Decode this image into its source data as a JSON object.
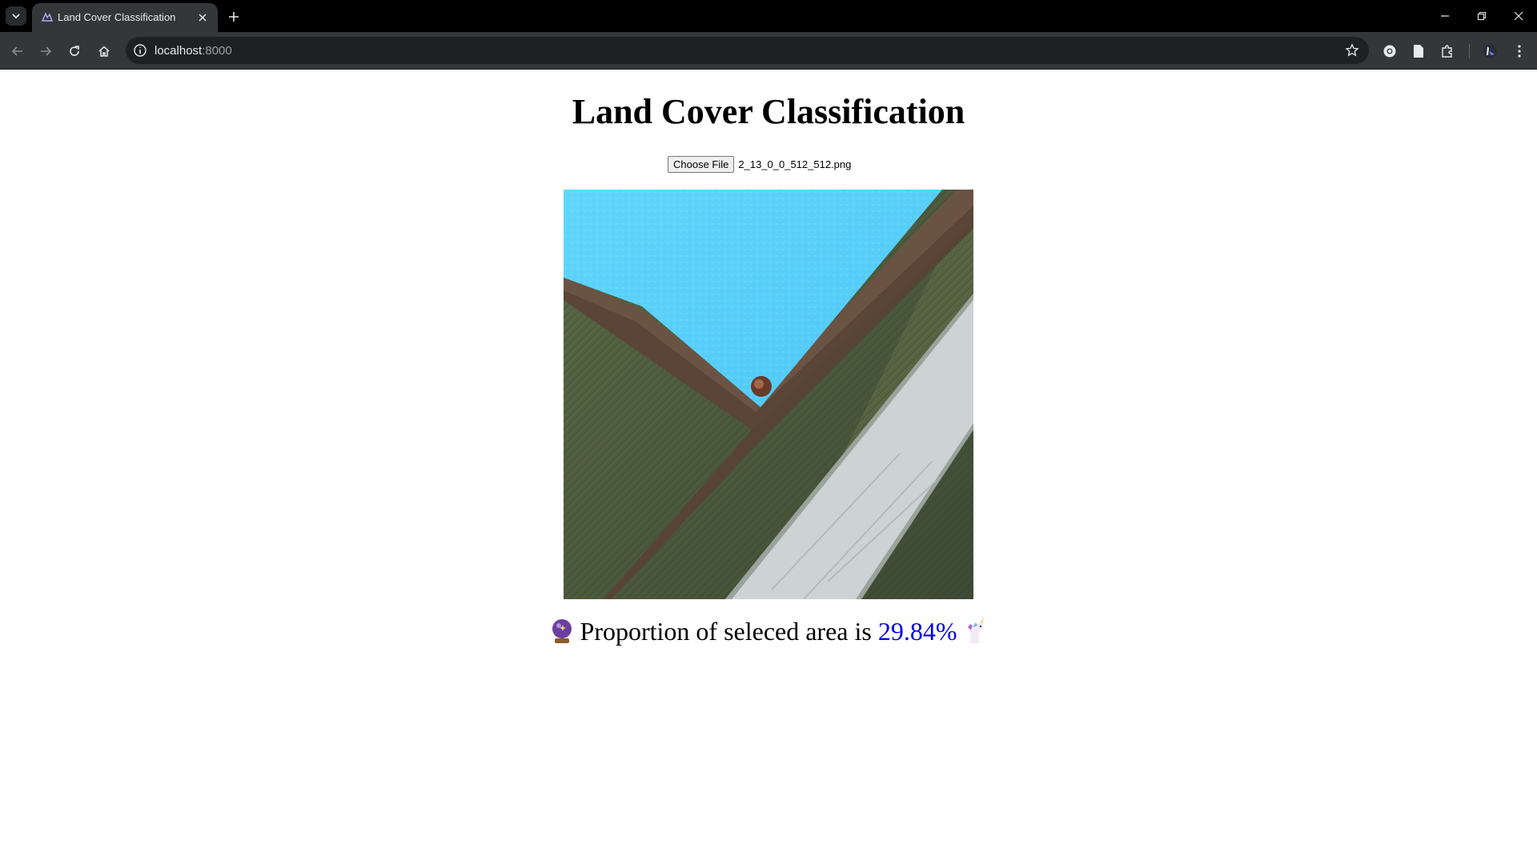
{
  "browser": {
    "tab_title": "Land Cover Classification",
    "url_host": "localhost",
    "url_port": ":8000"
  },
  "page": {
    "title": "Land Cover Classification",
    "file_input": {
      "button_label": "Choose File",
      "file_name": "2_13_0_0_512_512.png"
    },
    "image": {
      "alt": "Aerial image with selected water area highlighted in light blue"
    },
    "result": {
      "prefix": "Proportion of seleced area is",
      "percentage": "29.84%",
      "leading_emoji": "crystal-ball-icon",
      "trailing_emoji": "unicorn-icon"
    }
  },
  "colors": {
    "highlight": "#5ad2ff",
    "percentage_text": "#0000ee"
  }
}
